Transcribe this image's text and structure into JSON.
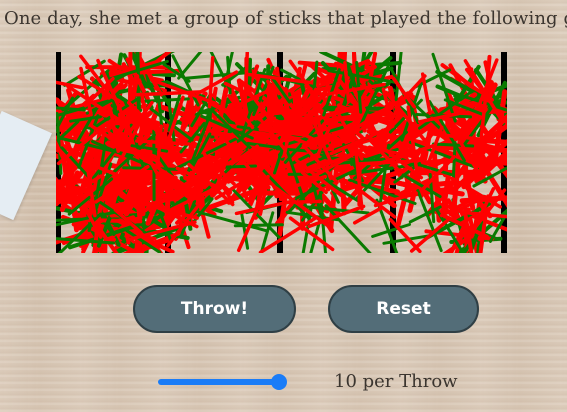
{
  "story": {
    "text": "One day, she met a group of sticks that played the following ga"
  },
  "canvas": {
    "stick_colors": [
      "#ff0000",
      "#0a7a00"
    ],
    "divider_color": "#000000"
  },
  "controls": {
    "throw_label": "Throw!",
    "reset_label": "Reset",
    "button_color": "#536d78",
    "slider_accent": "#1a7cf7",
    "per_throw_label": "10 per Throw"
  }
}
